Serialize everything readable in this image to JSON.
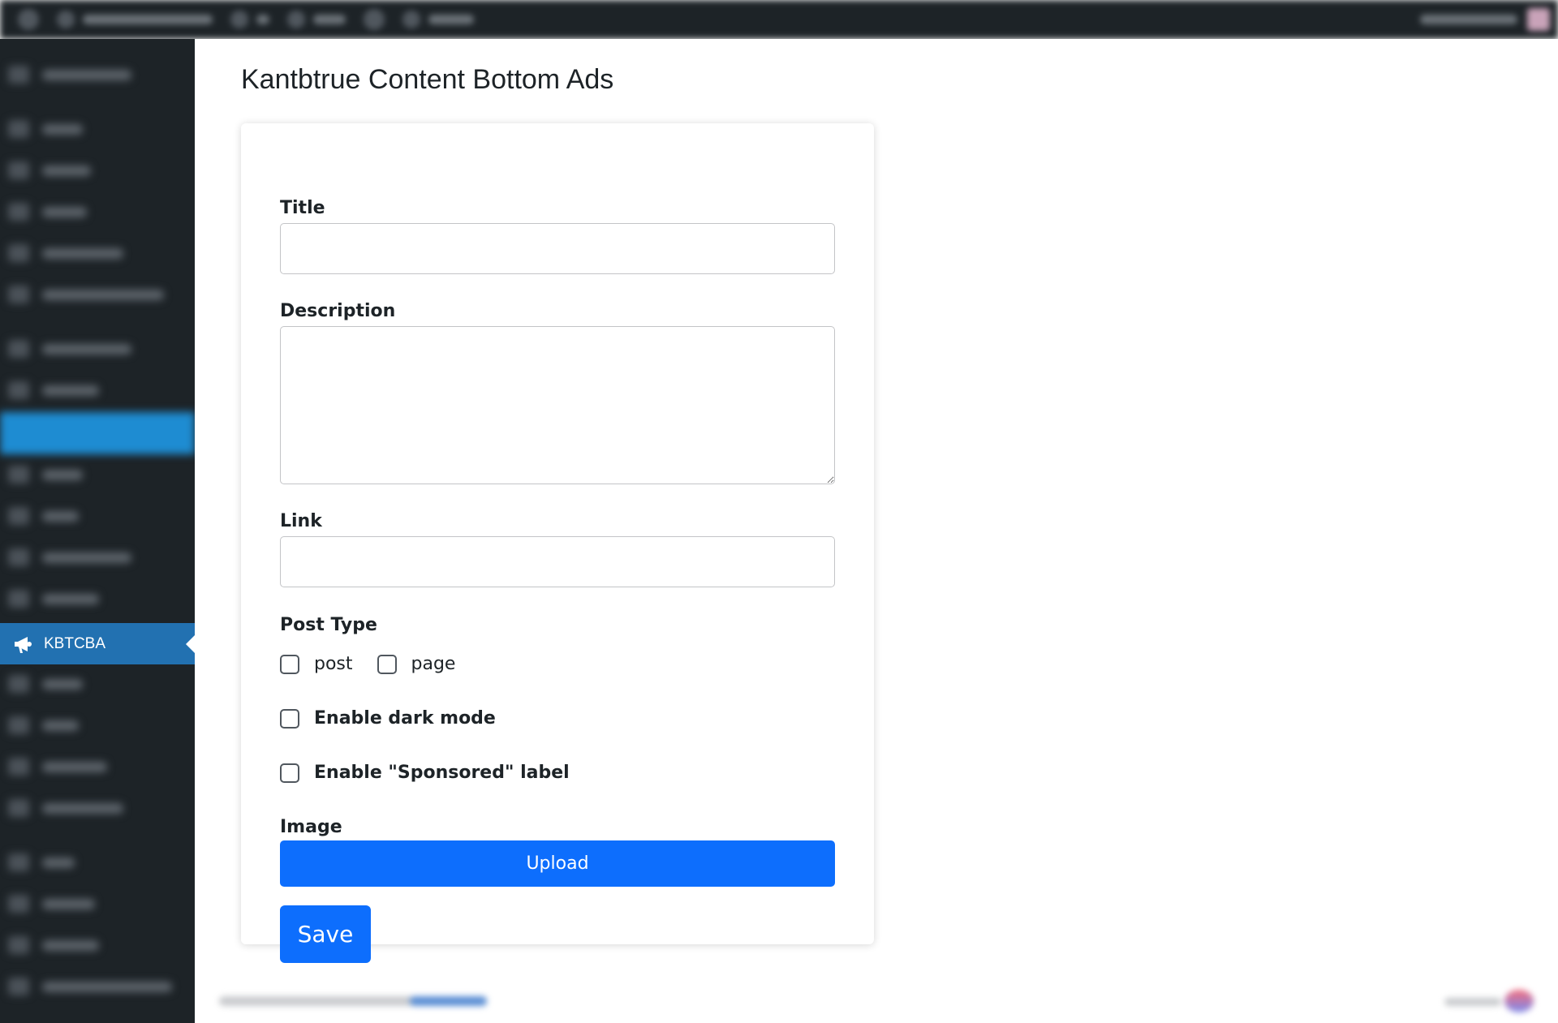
{
  "page": {
    "title": "Kantbtrue Content Bottom Ads"
  },
  "sidebar": {
    "active_item": {
      "label": "KBTCBA",
      "icon": "megaphone-icon"
    }
  },
  "form": {
    "title_label": "Title",
    "title_value": "",
    "description_label": "Description",
    "description_value": "",
    "link_label": "Link",
    "link_value": "",
    "post_type_label": "Post Type",
    "post_types": [
      {
        "label": "post",
        "checked": false
      },
      {
        "label": "page",
        "checked": false
      }
    ],
    "dark_mode_label": "Enable dark mode",
    "dark_mode_checked": false,
    "sponsored_label": "Enable \"Sponsored\" label",
    "sponsored_checked": false,
    "image_label": "Image",
    "upload_label": "Upload",
    "save_label": "Save"
  },
  "colors": {
    "primary_button": "#0d6efd",
    "sidebar_bg": "#1d2327",
    "sidebar_active": "#2271b1"
  }
}
